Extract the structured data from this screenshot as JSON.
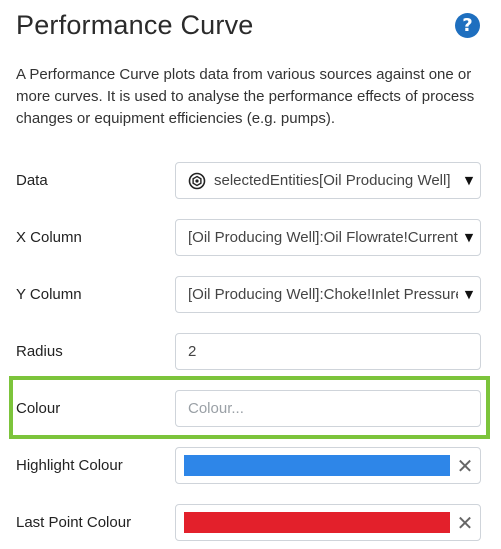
{
  "header": {
    "title": "Performance Curve",
    "help_icon": "?"
  },
  "description": "A Performance Curve plots data from various sources against one or more curves. It is used to analyse the performance effects of process changes or equipment efficiencies (e.g. pumps).",
  "fields": {
    "data": {
      "label": "Data",
      "value": "selectedEntities[Oil Producing Well]",
      "icon": "entity-icon"
    },
    "x_column": {
      "label": "X Column",
      "value": "[Oil Producing Well]:Oil Flowrate!Current"
    },
    "y_column": {
      "label": "Y Column",
      "value": "[Oil Producing Well]:Choke!Inlet Pressure"
    },
    "radius": {
      "label": "Radius",
      "value": "2"
    },
    "colour": {
      "label": "Colour",
      "placeholder": "Colour..."
    },
    "highlight_colour": {
      "label": "Highlight Colour",
      "color": "#2e86e8"
    },
    "last_point_colour": {
      "label": "Last Point Colour",
      "color": "#e3202b"
    }
  },
  "colors": {
    "accent": "#7cc43b",
    "help": "#1e6fbf"
  }
}
